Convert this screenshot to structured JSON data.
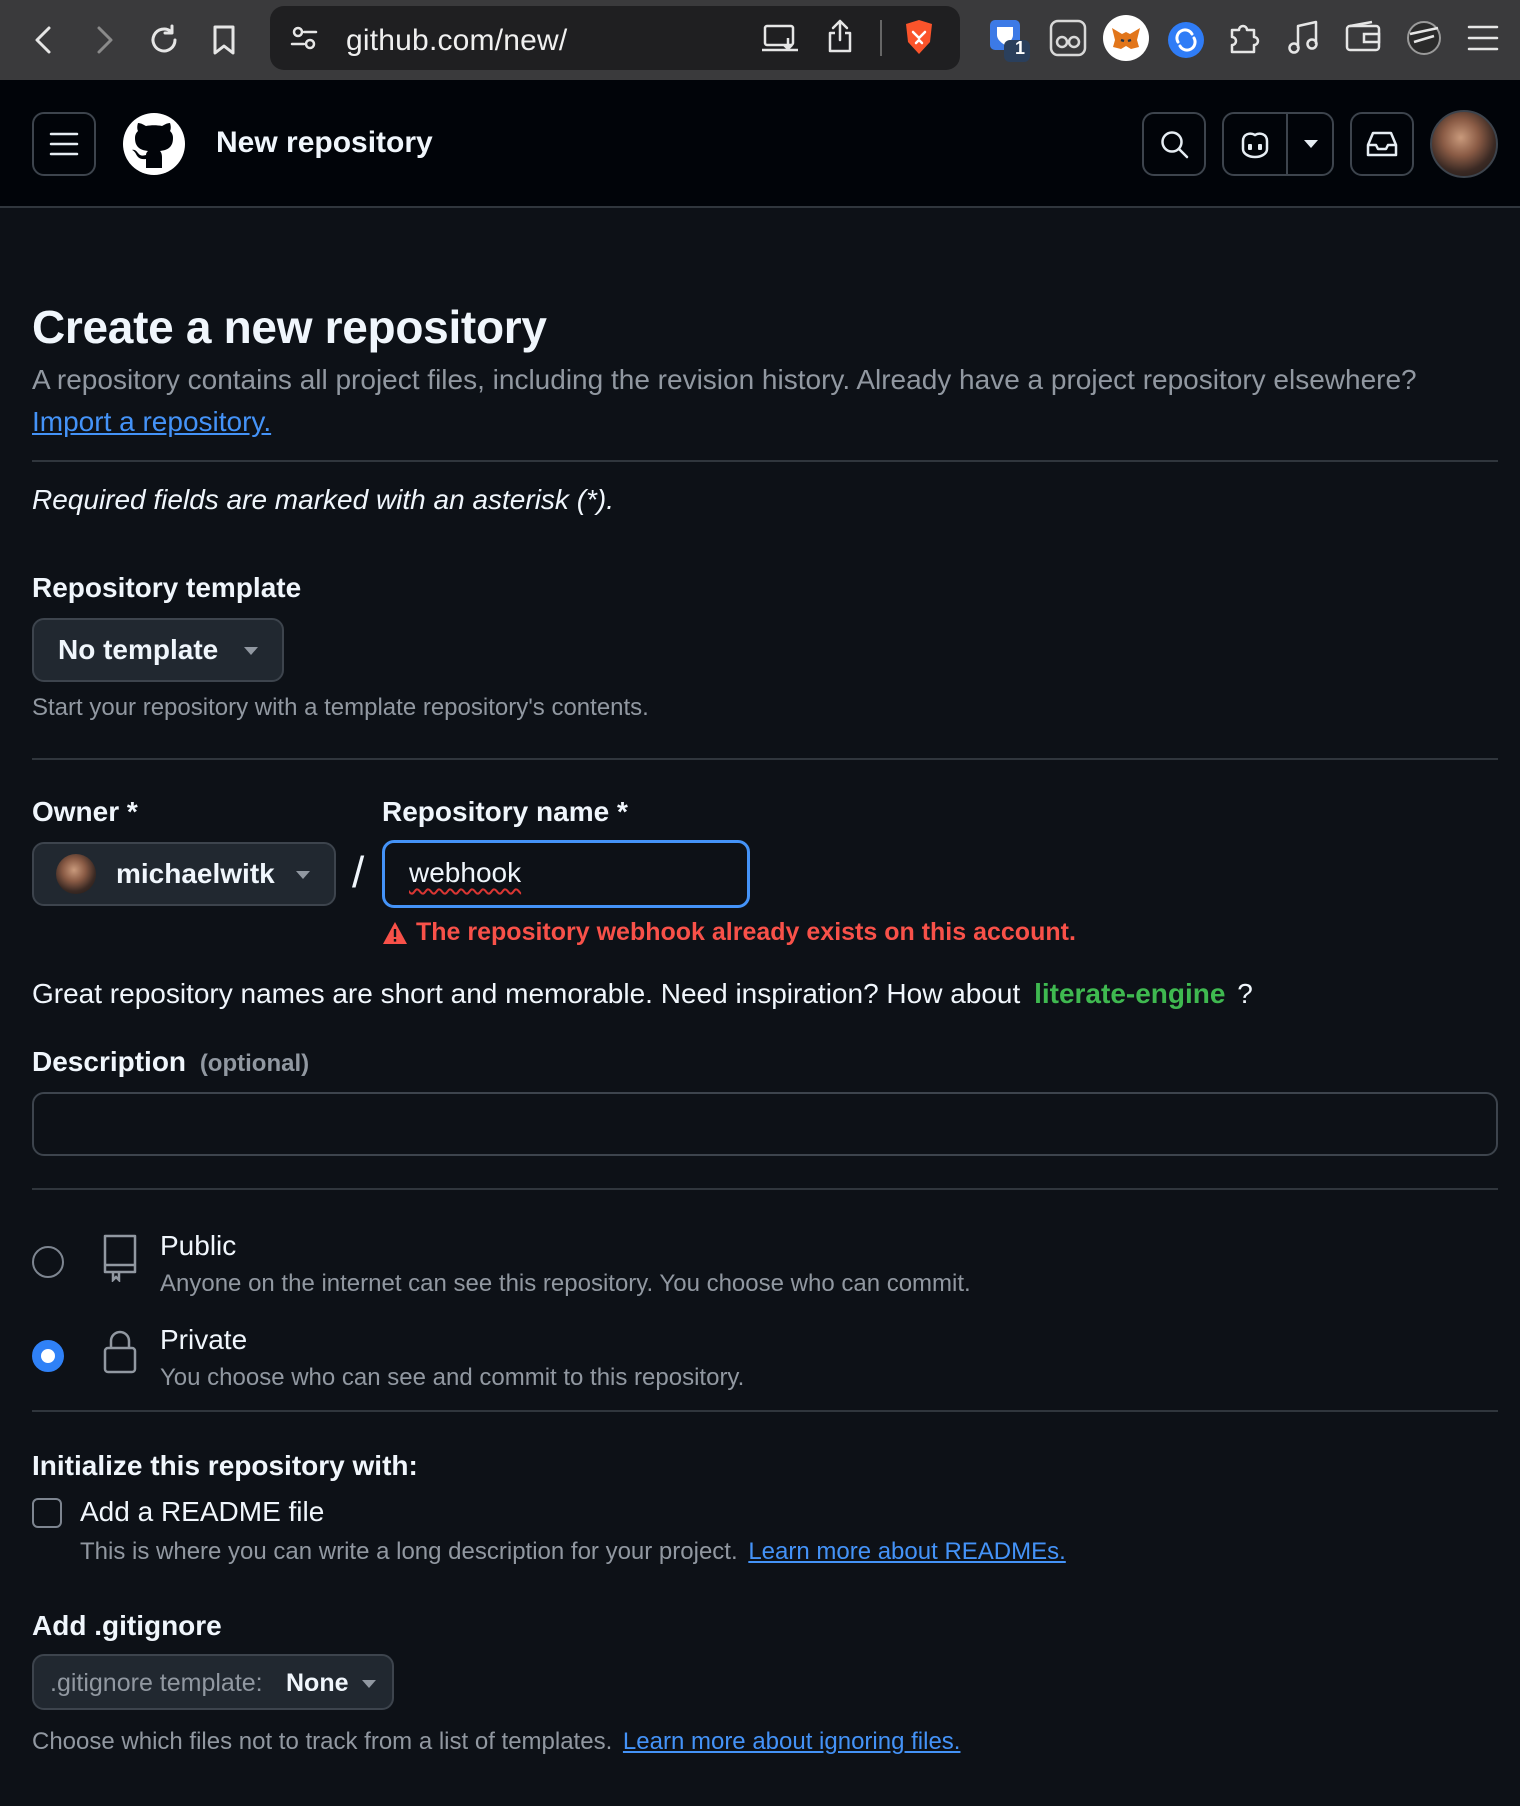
{
  "browser": {
    "url": "github.com/new/",
    "extension_badge": "1"
  },
  "header": {
    "context_title": "New repository"
  },
  "page": {
    "title": "Create a new repository",
    "lead": "A repository contains all project files, including the revision history. Already have a project repository elsewhere?",
    "import_link": "Import a repository.",
    "required_note": "Required fields are marked with an asterisk (*)."
  },
  "template": {
    "label": "Repository template",
    "value": "No template",
    "help": "Start your repository with a template repository's contents."
  },
  "owner": {
    "label": "Owner *",
    "value": "michaelwitk"
  },
  "separator": "/",
  "repo_name": {
    "label": "Repository name *",
    "value": "webhook",
    "error": "The repository webhook already exists on this account."
  },
  "suggestion": {
    "text": "Great repository names are short and memorable. Need inspiration? How about",
    "name": "literate-engine",
    "suffix": "?"
  },
  "description": {
    "label": "Description",
    "optional": "(optional)",
    "value": ""
  },
  "visibility": {
    "selected": "private",
    "options": [
      {
        "key": "public",
        "title": "Public",
        "desc": "Anyone on the internet can see this repository. You choose who can commit."
      },
      {
        "key": "private",
        "title": "Private",
        "desc": "You choose who can see and commit to this repository."
      }
    ]
  },
  "init": {
    "heading": "Initialize this repository with:",
    "readme_label": "Add a README file",
    "readme_checked": false,
    "readme_help": "This is where you can write a long description for your project.",
    "readme_link": "Learn more about READMEs."
  },
  "gitignore": {
    "label": "Add .gitignore",
    "prefix": ".gitignore template:",
    "value": "None",
    "help": "Choose which files not to track from a list of templates.",
    "link": "Learn more about ignoring files."
  },
  "colors": {
    "accent": "#4493f8",
    "success": "#3fb950",
    "danger": "#f85149",
    "background": "#0d1117"
  }
}
